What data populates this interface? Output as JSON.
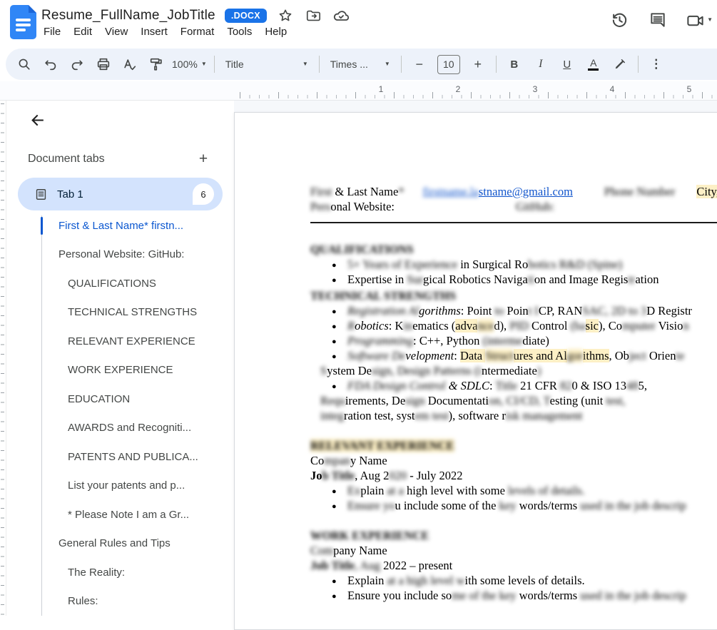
{
  "topbar": {
    "title": "Resume_FullName_JobTitle",
    "badge": ".DOCX",
    "menus": [
      "File",
      "Edit",
      "View",
      "Insert",
      "Format",
      "Tools",
      "Help"
    ]
  },
  "toolbar": {
    "zoom": "100%",
    "style": "Title",
    "font": "Times ...",
    "font_size": "10",
    "bold_label": "B",
    "italic_label": "I",
    "underline_label": "U",
    "text_color_label": "A",
    "more_label": "⋮",
    "minus_label": "−",
    "plus_label": "+"
  },
  "ruler": {
    "marks": [
      "1",
      "2",
      "3",
      "4",
      "5"
    ]
  },
  "sidebar": {
    "header": "Document tabs",
    "add_tab_label": "+",
    "back_label": "←",
    "tab": {
      "label": "Tab 1",
      "badge": "6"
    },
    "outline": [
      {
        "label": "First & Last Name* firstn...",
        "level": 1,
        "active": true
      },
      {
        "label": "Personal Website: GitHub:",
        "level": 1
      },
      {
        "label": "QUALIFICATIONS",
        "level": 2
      },
      {
        "label": "TECHNICAL STRENGTHS",
        "level": 2
      },
      {
        "label": "RELEVANT EXPERIENCE",
        "level": 2
      },
      {
        "label": "WORK EXPERIENCE",
        "level": 2
      },
      {
        "label": "EDUCATION",
        "level": 2
      },
      {
        "label": "AWARDS and Recogniti...",
        "level": 2
      },
      {
        "label": "PATENTS AND PUBLICA...",
        "level": 2
      },
      {
        "label": "List your patents and p...",
        "level": 2
      },
      {
        "label": "* Please Note I am a Gr...",
        "level": 2
      },
      {
        "label": "General Rules and Tips",
        "level": 1
      },
      {
        "label": "The Reality:",
        "level": 2
      },
      {
        "label": "Rules:",
        "level": 2
      }
    ]
  },
  "document": {
    "lines": [
      {
        "type": "row",
        "seg": [
          {
            "t": "First",
            "blur": 1
          },
          {
            "t": " & Last Name"
          },
          {
            "t": "*",
            "blur": 1
          },
          {
            "t": "firstname.la",
            "link": 1,
            "blur": 1,
            "ml": 26
          },
          {
            "t": "stname@gmail.com",
            "link": 1
          },
          {
            "t": "Phone Number",
            "blur": 1,
            "ml": 44
          },
          {
            "t": "City, Sta",
            "hl": 1,
            "ml": 30
          }
        ]
      },
      {
        "type": "row",
        "seg": [
          {
            "t": "Pers",
            "blur": 1
          },
          {
            "t": "onal Website:"
          },
          {
            "t": "GitHub:",
            "blur": 1,
            "ml": 170
          }
        ]
      },
      {
        "type": "rule"
      },
      {
        "type": "spacer"
      },
      {
        "type": "h",
        "seg": [
          {
            "t": "QUALIFICATIONS",
            "b": 1,
            "blur": 1
          }
        ]
      },
      {
        "type": "bullet",
        "seg": [
          {
            "t": "5+ Years of Experience ",
            "blur": 1
          },
          {
            "t": "in Surgical Ro"
          },
          {
            "t": "botics R&D (Spine)",
            "blur": 1
          }
        ]
      },
      {
        "type": "bullet",
        "seg": [
          {
            "t": "Expertise in "
          },
          {
            "t": "Sur",
            "blur": 1
          },
          {
            "t": "gical Robotics Naviga"
          },
          {
            "t": "ti",
            "blur": 1
          },
          {
            "t": "on and Image Regis"
          },
          {
            "t": "tr",
            "blur": 1
          },
          {
            "t": "ation"
          }
        ]
      },
      {
        "type": "h",
        "seg": [
          {
            "t": "TECHNICAL STRENGTHS",
            "b": 1,
            "blur": 1
          }
        ]
      },
      {
        "type": "bullet",
        "seg": [
          {
            "t": "Registration Al",
            "i": 1,
            "blur": 1
          },
          {
            "t": "gorithms",
            "i": 1
          },
          {
            "t": ": Point "
          },
          {
            "t": "to",
            "blur": 1
          },
          {
            "t": " Poin"
          },
          {
            "t": "t I",
            "blur": 1
          },
          {
            "t": "CP, RAN"
          },
          {
            "t": "SAC, 2D to 3",
            "blur": 1
          },
          {
            "t": "D Registr"
          }
        ]
      },
      {
        "type": "bullet",
        "seg": [
          {
            "t": "R",
            "i": 1,
            "blur": 1
          },
          {
            "t": "obotics",
            "i": 1
          },
          {
            "t": ": K"
          },
          {
            "t": "in",
            "blur": 1
          },
          {
            "t": "ematics ("
          },
          {
            "t": "adva",
            "hl": 1
          },
          {
            "t": "nce",
            "hl": 1,
            "blur": 1
          },
          {
            "t": "d),"
          },
          {
            "t": " PID ",
            "blur": 1
          },
          {
            "t": "Control "
          },
          {
            "t": "(ba",
            "blur": 1
          },
          {
            "t": "sic",
            "hl": 1
          },
          {
            "t": "), Co"
          },
          {
            "t": "mputer",
            "blur": 1
          },
          {
            "t": " Visio"
          },
          {
            "t": "n",
            "blur": 1
          }
        ]
      },
      {
        "type": "bullet",
        "seg": [
          {
            "t": "Programm",
            "i": 1,
            "blur": 1
          },
          {
            "t": "ing",
            "i": 1,
            "blur": 1
          },
          {
            "t": ": C++, Python "
          },
          {
            "t": "(interme",
            "blur": 1
          },
          {
            "t": "diate)"
          }
        ]
      },
      {
        "type": "bullet",
        "seg": [
          {
            "t": "Software De",
            "i": 1,
            "blur": 1
          },
          {
            "t": "velopment",
            "i": 1
          },
          {
            "t": ": "
          },
          {
            "t": "Data ",
            "hl": 1
          },
          {
            "t": "Struct",
            "hl": 1,
            "blur": 1
          },
          {
            "t": "ures and Al",
            "hl": 1
          },
          {
            "t": "gor",
            "hl": 1,
            "blur": 1
          },
          {
            "t": "ithms",
            "hl": 1
          },
          {
            "t": ", Ob"
          },
          {
            "t": "ject",
            "blur": 1
          },
          {
            "t": " Orien"
          },
          {
            "t": "te",
            "blur": 1
          }
        ]
      },
      {
        "type": "cont",
        "seg": [
          {
            "t": "S",
            "blur": 1
          },
          {
            "t": "ystem De"
          },
          {
            "t": "sign, Design Patterns (i",
            "blur": 1
          },
          {
            "t": "ntermediate"
          },
          {
            "t": ")",
            "blur": 1
          }
        ]
      },
      {
        "type": "bullet",
        "seg": [
          {
            "t": "FDA Design Control ",
            "i": 1,
            "blur": 1
          },
          {
            "t": "& SDLC",
            "i": 1
          },
          {
            "t": ": "
          },
          {
            "t": "Title",
            "blur": 1
          },
          {
            "t": " 21 CFR "
          },
          {
            "t": "82",
            "blur": 1
          },
          {
            "t": "0 & ISO 13"
          },
          {
            "t": "48",
            "blur": 1
          },
          {
            "t": "5,"
          }
        ]
      },
      {
        "type": "cont",
        "seg": [
          {
            "t": "Requ",
            "blur": 1
          },
          {
            "t": "irements, De"
          },
          {
            "t": "sign ",
            "blur": 1
          },
          {
            "t": "Documentati"
          },
          {
            "t": "on, CI/CD, T",
            "blur": 1
          },
          {
            "t": "esting (unit "
          },
          {
            "t": "test,",
            "blur": 1
          }
        ]
      },
      {
        "type": "cont",
        "seg": [
          {
            "t": "integ",
            "blur": 1
          },
          {
            "t": "ration test, syst"
          },
          {
            "t": "em test",
            "blur": 1
          },
          {
            "t": "), software r"
          },
          {
            "t": "isk management",
            "blur": 1
          }
        ]
      },
      {
        "type": "spacer"
      },
      {
        "type": "h",
        "seg": [
          {
            "t": "RELEVANT EXPERIENCE",
            "b": 1,
            "blur": 1,
            "hl": 1
          }
        ]
      },
      {
        "type": "p",
        "seg": [
          {
            "t": "Co"
          },
          {
            "t": "mpan",
            "blur": 1
          },
          {
            "t": "y Name"
          }
        ]
      },
      {
        "type": "p",
        "seg": [
          {
            "t": "Jo",
            "b": 1
          },
          {
            "t": "b Title",
            "b": 1,
            "blur": 1
          },
          {
            "t": ", Aug 2"
          },
          {
            "t": "020 ",
            "blur": 1
          },
          {
            "t": "- July 2022"
          }
        ]
      },
      {
        "type": "bullet",
        "seg": [
          {
            "t": "Ex",
            "blur": 1
          },
          {
            "t": "plain "
          },
          {
            "t": "at a",
            "blur": 1
          },
          {
            "t": " high level with some "
          },
          {
            "t": "levels of details.",
            "blur": 1
          }
        ]
      },
      {
        "type": "bullet",
        "seg": [
          {
            "t": "Ensure yo",
            "blur": 1
          },
          {
            "t": "u include some of the "
          },
          {
            "t": "key",
            "blur": 1
          },
          {
            "t": " words/terms "
          },
          {
            "t": "used in the job descrip",
            "blur": 1
          }
        ]
      },
      {
        "type": "spacer"
      },
      {
        "type": "h",
        "seg": [
          {
            "t": "WORK EXPERIENCE",
            "b": 1,
            "blur": 1
          }
        ]
      },
      {
        "type": "p",
        "seg": [
          {
            "t": "Com",
            "blur": 1
          },
          {
            "t": "pany Name"
          }
        ]
      },
      {
        "type": "p",
        "seg": [
          {
            "t": "Job Title",
            "b": 1,
            "blur": 1
          },
          {
            "t": ", Aug ",
            "blur": 1
          },
          {
            "t": "2022 – present"
          }
        ]
      },
      {
        "type": "bullet",
        "seg": [
          {
            "t": "Explain "
          },
          {
            "t": "at a high level w",
            "blur": 1
          },
          {
            "t": "ith some levels of details."
          }
        ]
      },
      {
        "type": "bullet",
        "seg": [
          {
            "t": "Ensure you include so"
          },
          {
            "t": "me of the key",
            "blur": 1
          },
          {
            "t": " words/terms "
          },
          {
            "t": "used in the job descrip",
            "blur": 1
          }
        ]
      }
    ]
  },
  "colors": {
    "accent_blue": "#1a73e8",
    "tab_pill_blue": "#d3e3fd",
    "active_outline_blue": "#0b57d0",
    "highlight_yellow": "#fdf0c6",
    "link_blue": "#1155cc",
    "icon_gray": "#444746"
  }
}
